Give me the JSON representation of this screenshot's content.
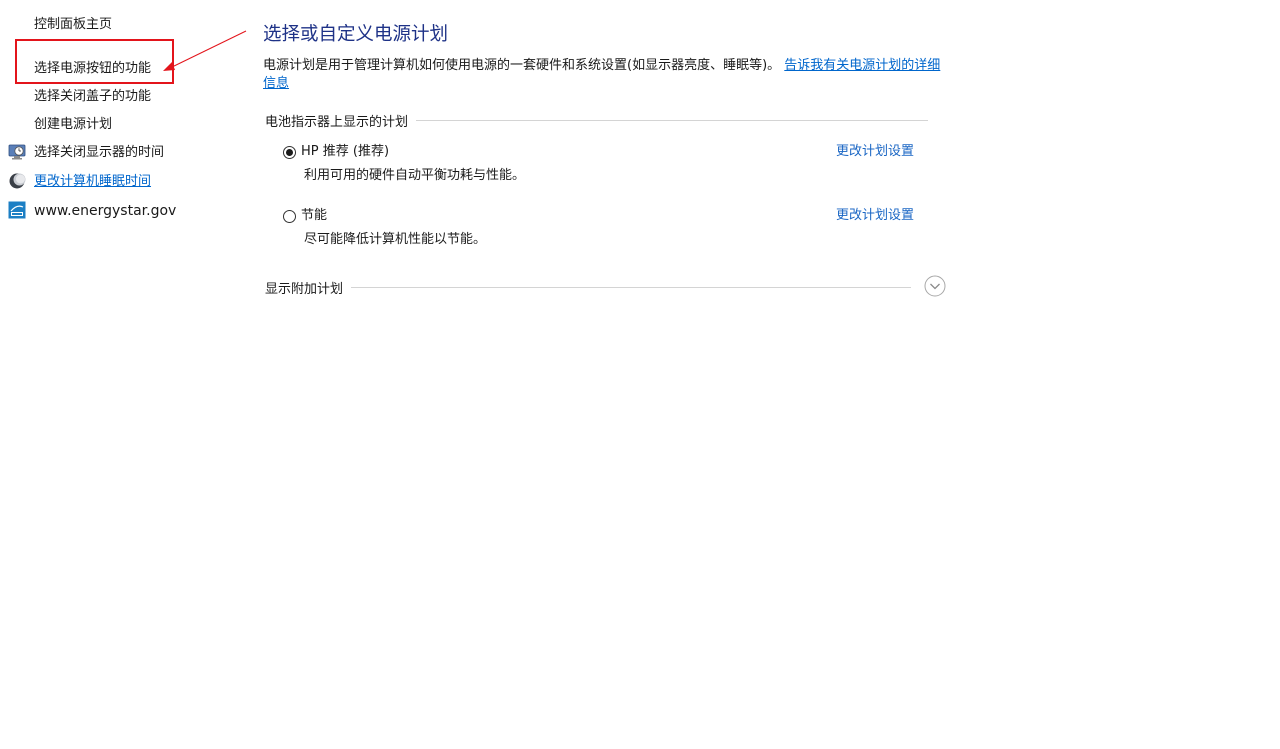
{
  "sidebar": {
    "home": "控制面板主页",
    "items": [
      {
        "label": "选择电源按钮的功能"
      },
      {
        "label": "选择关闭盖子的功能"
      },
      {
        "label": "创建电源计划"
      },
      {
        "label": "选择关闭显示器的时间",
        "icon": "display-clock-icon"
      },
      {
        "label": "更改计算机睡眠时间",
        "icon": "moon-sleep-icon"
      },
      {
        "label": "www.energystar.gov",
        "icon": "energy-star-icon"
      }
    ]
  },
  "main": {
    "title": "选择或自定义电源计划",
    "description": "电源计划是用于管理计算机如何使用电源的一套硬件和系统设置(如显示器亮度、睡眠等)。",
    "description_link": "告诉我有关电源计划的详细信息",
    "battery_section": "电池指示器上显示的计划",
    "plans": [
      {
        "name": "HP 推荐 (推荐)",
        "desc": "利用可用的硬件自动平衡功耗与性能。",
        "link": "更改计划设置",
        "selected": true
      },
      {
        "name": "节能",
        "desc": "尽可能降低计算机性能以节能。",
        "link": "更改计划设置",
        "selected": false
      }
    ],
    "additional_section": "显示附加计划"
  },
  "colors": {
    "title": "#1e3287",
    "link": "#0066cc",
    "highlight": "#e3141b"
  }
}
